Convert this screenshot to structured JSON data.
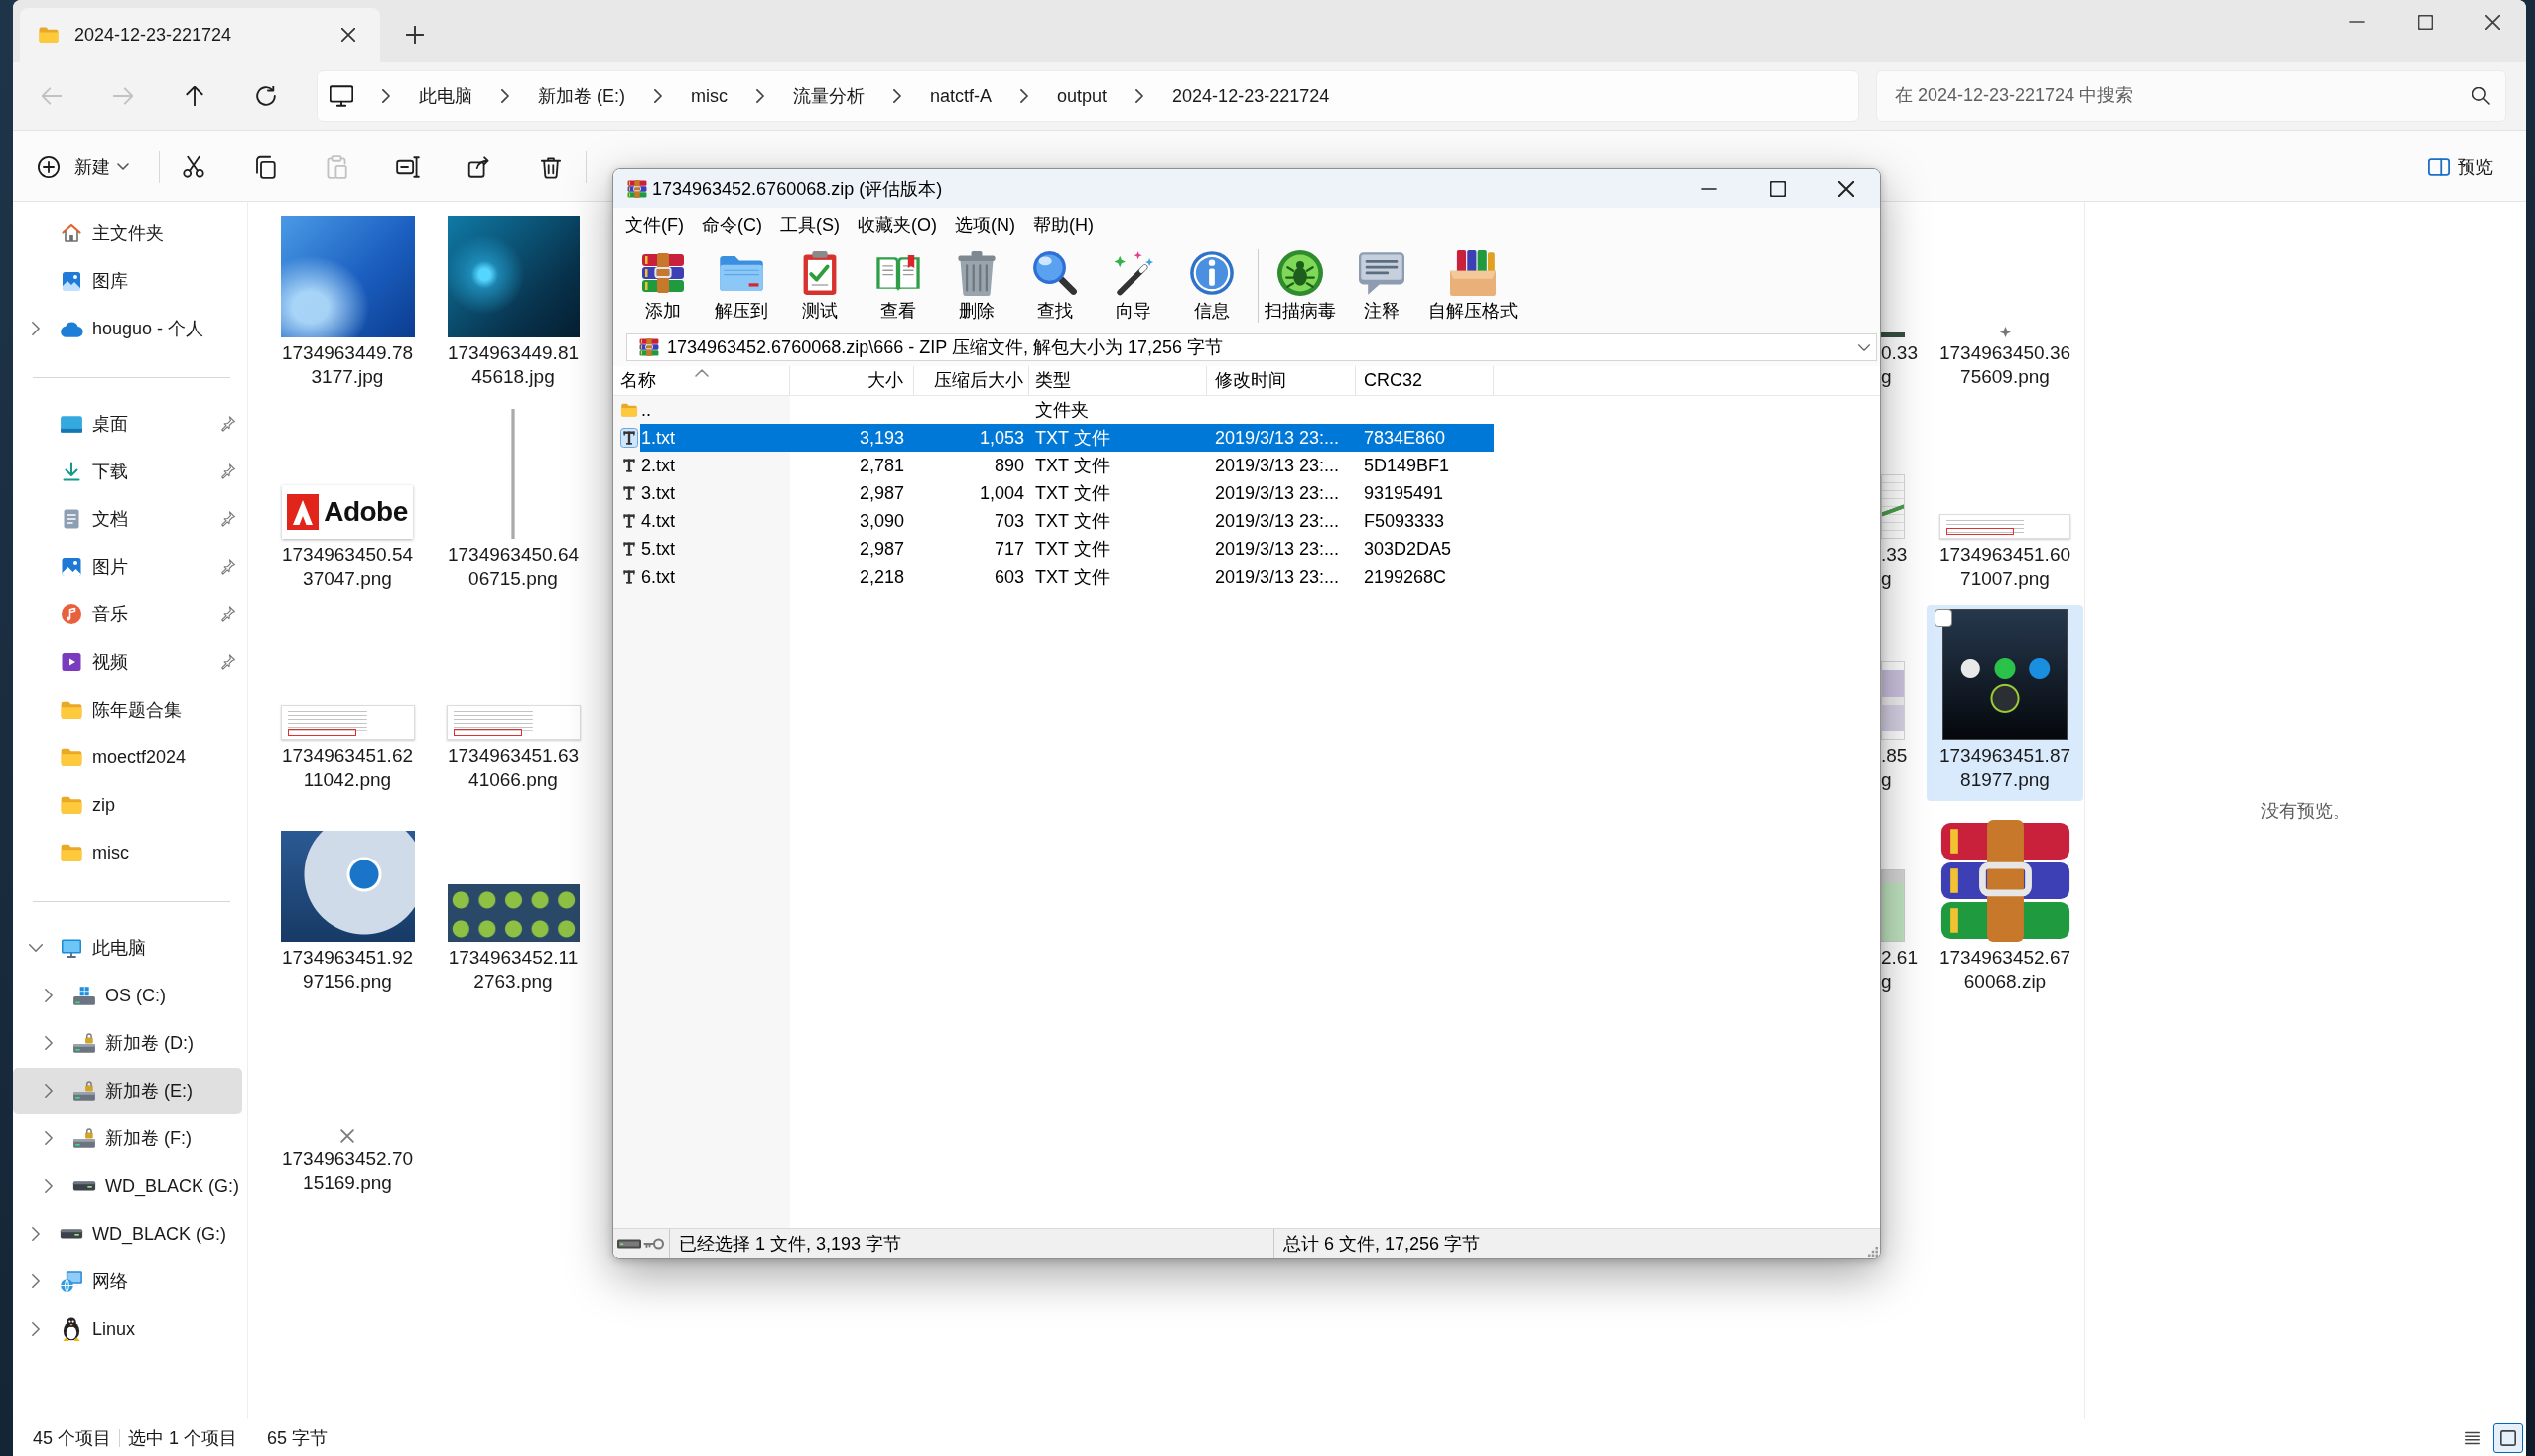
{
  "explorer": {
    "tab": {
      "title": "2024-12-23-221724"
    },
    "nav_buttons": [
      {
        "kind": "back",
        "disabled": true
      },
      {
        "kind": "forward",
        "disabled": true
      },
      {
        "kind": "up",
        "disabled": false
      },
      {
        "kind": "refresh",
        "disabled": false
      }
    ],
    "breadcrumb": [
      "此电脑",
      "新加卷 (E:)",
      "misc",
      "流量分析",
      "natctf-A",
      "output",
      "2024-12-23-221724"
    ],
    "search": {
      "placeholder": "在 2024-12-23-221724 中搜索"
    },
    "command_bar": {
      "new_label": "新建",
      "actions": [
        {
          "kind": "cut",
          "disabled": false
        },
        {
          "kind": "copy",
          "disabled": false
        },
        {
          "kind": "paste",
          "disabled": true
        },
        {
          "kind": "rename",
          "disabled": false
        },
        {
          "kind": "share",
          "disabled": false
        },
        {
          "kind": "delete",
          "disabled": false
        }
      ],
      "preview_label": "预览"
    },
    "sidebar": [
      {
        "items": [
          {
            "label": "主文件夹",
            "kind": "home",
            "selected": false
          },
          {
            "label": "图库",
            "kind": "gallery",
            "selected": false
          },
          {
            "label": "houguo - 个人",
            "kind": "cloud",
            "expanded": false,
            "selected": false
          }
        ]
      },
      {
        "items": [
          {
            "label": "桌面",
            "kind": "desktop",
            "pinned": true,
            "selected": false
          },
          {
            "label": "下载",
            "kind": "downloads",
            "pinned": true,
            "selected": false
          },
          {
            "label": "文档",
            "kind": "documents",
            "pinned": true,
            "selected": false
          },
          {
            "label": "图片",
            "kind": "pictures",
            "pinned": true,
            "selected": false
          },
          {
            "label": "音乐",
            "kind": "music",
            "pinned": true,
            "selected": false
          },
          {
            "label": "视频",
            "kind": "videos",
            "pinned": true,
            "selected": false
          },
          {
            "label": "陈年题合集",
            "kind": "folder",
            "pinned": false,
            "selected": false
          },
          {
            "label": "moectf2024",
            "kind": "folder",
            "pinned": false,
            "selected": false
          },
          {
            "label": "zip",
            "kind": "folder",
            "pinned": false,
            "selected": false
          },
          {
            "label": "misc",
            "kind": "folder",
            "pinned": false,
            "selected": false
          }
        ]
      },
      {
        "items": [
          {
            "label": "此电脑",
            "kind": "pc",
            "expanded": true,
            "selected": false,
            "children": [
              {
                "label": "OS (C:)",
                "kind": "system-drive",
                "expanded": false,
                "selected": false
              },
              {
                "label": "新加卷 (D:)",
                "kind": "drive",
                "expanded": false,
                "selected": false
              },
              {
                "label": "新加卷 (E:)",
                "kind": "drive",
                "expanded": false,
                "selected": true
              },
              {
                "label": "新加卷 (F:)",
                "kind": "drive",
                "expanded": false,
                "selected": false
              },
              {
                "label": "WD_BLACK (G:)",
                "kind": "external-drive",
                "expanded": false,
                "selected": false
              }
            ]
          },
          {
            "label": "WD_BLACK (G:)",
            "kind": "external-drive",
            "expanded": false,
            "selected": false
          },
          {
            "label": "网络",
            "kind": "network",
            "expanded": false,
            "selected": false
          },
          {
            "label": "Linux",
            "kind": "linux",
            "expanded": false,
            "selected": false
          }
        ]
      }
    ],
    "file_grid": {
      "rows": [
        {
          "items": [
            {
              "name": "1734963449.783177.jpg",
              "kind": "photo",
              "selected": false
            },
            {
              "name": "1734963449.8145618.jpg",
              "kind": "photo-dark",
              "selected": false
            }
          ],
          "cut_item": {
            "kind": "strip",
            "visible_text": [
              "0.33",
              "g"
            ]
          },
          "end_item": {
            "name": "1734963450.3675609.png",
            "kind": "tiny",
            "selected": false
          }
        },
        {
          "items": [
            {
              "name": "1734963450.5437047.png",
              "kind": "logo",
              "thumbnail_text": "Adobe",
              "selected": false
            },
            {
              "name": "1734963450.6406715.png",
              "kind": "thin-strip",
              "selected": false
            }
          ],
          "cut_item": {
            "kind": "chart",
            "visible_text": [
              ".33",
              "g"
            ]
          },
          "end_item": {
            "name": "1734963451.6071007.png",
            "kind": "snippet",
            "selected": false
          }
        },
        {
          "items": [
            {
              "name": "1734963451.6211042.png",
              "kind": "screenshot",
              "selected": false
            },
            {
              "name": "1734963451.6341066.png",
              "kind": "screenshot",
              "selected": false
            }
          ],
          "cut_item": {
            "kind": "document",
            "visible_text": [
              ".85",
              "g"
            ]
          },
          "end_item": {
            "name": "1734963451.8781977.png",
            "kind": "phone-screen",
            "selected": true
          }
        },
        {
          "items": [
            {
              "name": "1734963451.9297156.png",
              "kind": "app-screen",
              "selected": false
            },
            {
              "name": "1734963452.112763.png",
              "kind": "pattern",
              "selected": false
            }
          ],
          "cut_item": {
            "kind": "window",
            "visible_text": [
              "2.61",
              "g"
            ]
          },
          "end_item": {
            "name": "1734963452.6760068.zip",
            "kind": "archive",
            "selected": false
          }
        },
        {
          "items": [
            {
              "name": "1734963452.7015169.png",
              "kind": "broken",
              "selected": false
            }
          ]
        }
      ]
    },
    "preview_pane": {
      "message": "没有预览。"
    },
    "status_bar": {
      "item_count": "45 个项目",
      "selection": "选中 1 个项目",
      "selection_size": "65 字节",
      "view_buttons": [
        {
          "kind": "details",
          "selected": false
        },
        {
          "kind": "large-icons",
          "selected": true
        }
      ]
    }
  },
  "archive_window": {
    "title": "1734963452.6760068.zip (评估版本)",
    "menu": [
      "文件(F)",
      "命令(C)",
      "工具(S)",
      "收藏夹(O)",
      "选项(N)",
      "帮助(H)"
    ],
    "toolbar_groups": [
      {
        "buttons": [
          {
            "label": "添加",
            "kind": "add"
          },
          {
            "label": "解压到",
            "kind": "extract"
          },
          {
            "label": "测试",
            "kind": "test"
          },
          {
            "label": "查看",
            "kind": "view"
          },
          {
            "label": "删除",
            "kind": "delete"
          },
          {
            "label": "查找",
            "kind": "find"
          },
          {
            "label": "向导",
            "kind": "wizard"
          },
          {
            "label": "信息",
            "kind": "info"
          }
        ]
      },
      {
        "buttons": [
          {
            "label": "扫描病毒",
            "kind": "scan"
          },
          {
            "label": "注释",
            "kind": "comment"
          },
          {
            "label": "自解压格式",
            "kind": "sfx"
          }
        ]
      }
    ],
    "path": "1734963452.6760068.zip\\666 - ZIP 压缩文件, 解包大小为 17,256 字节",
    "columns": [
      {
        "label": "名称",
        "sorted": true
      },
      {
        "label": "大小",
        "sorted": false
      },
      {
        "label": "压缩后大小",
        "sorted": false
      },
      {
        "label": "类型",
        "sorted": false
      },
      {
        "label": "修改时间",
        "sorted": false
      },
      {
        "label": "CRC32",
        "sorted": false
      }
    ],
    "rows": [
      {
        "kind": "parent",
        "name": "..",
        "type": "文件夹",
        "selected": false
      },
      {
        "kind": "file",
        "name": "1.txt",
        "size": "3,193",
        "packed": "1,053",
        "type": "TXT 文件",
        "modified": "2019/3/13 23:...",
        "crc32": "7834E860",
        "selected": true
      },
      {
        "kind": "file",
        "name": "2.txt",
        "size": "2,781",
        "packed": "890",
        "type": "TXT 文件",
        "modified": "2019/3/13 23:...",
        "crc32": "5D149BF1",
        "selected": false
      },
      {
        "kind": "file",
        "name": "3.txt",
        "size": "2,987",
        "packed": "1,004",
        "type": "TXT 文件",
        "modified": "2019/3/13 23:...",
        "crc32": "93195491",
        "selected": false
      },
      {
        "kind": "file",
        "name": "4.txt",
        "size": "3,090",
        "packed": "703",
        "type": "TXT 文件",
        "modified": "2019/3/13 23:...",
        "crc32": "F5093333",
        "selected": false
      },
      {
        "kind": "file",
        "name": "5.txt",
        "size": "2,987",
        "packed": "717",
        "type": "TXT 文件",
        "modified": "2019/3/13 23:...",
        "crc32": "303D2DA5",
        "selected": false
      },
      {
        "kind": "file",
        "name": "6.txt",
        "size": "2,218",
        "packed": "603",
        "type": "TXT 文件",
        "modified": "2019/3/13 23:...",
        "crc32": "2199268C",
        "selected": false
      }
    ],
    "status": {
      "selection": "已经选择 1 文件, 3,193 字节",
      "total": "总计 6 文件, 17,256 字节"
    }
  }
}
